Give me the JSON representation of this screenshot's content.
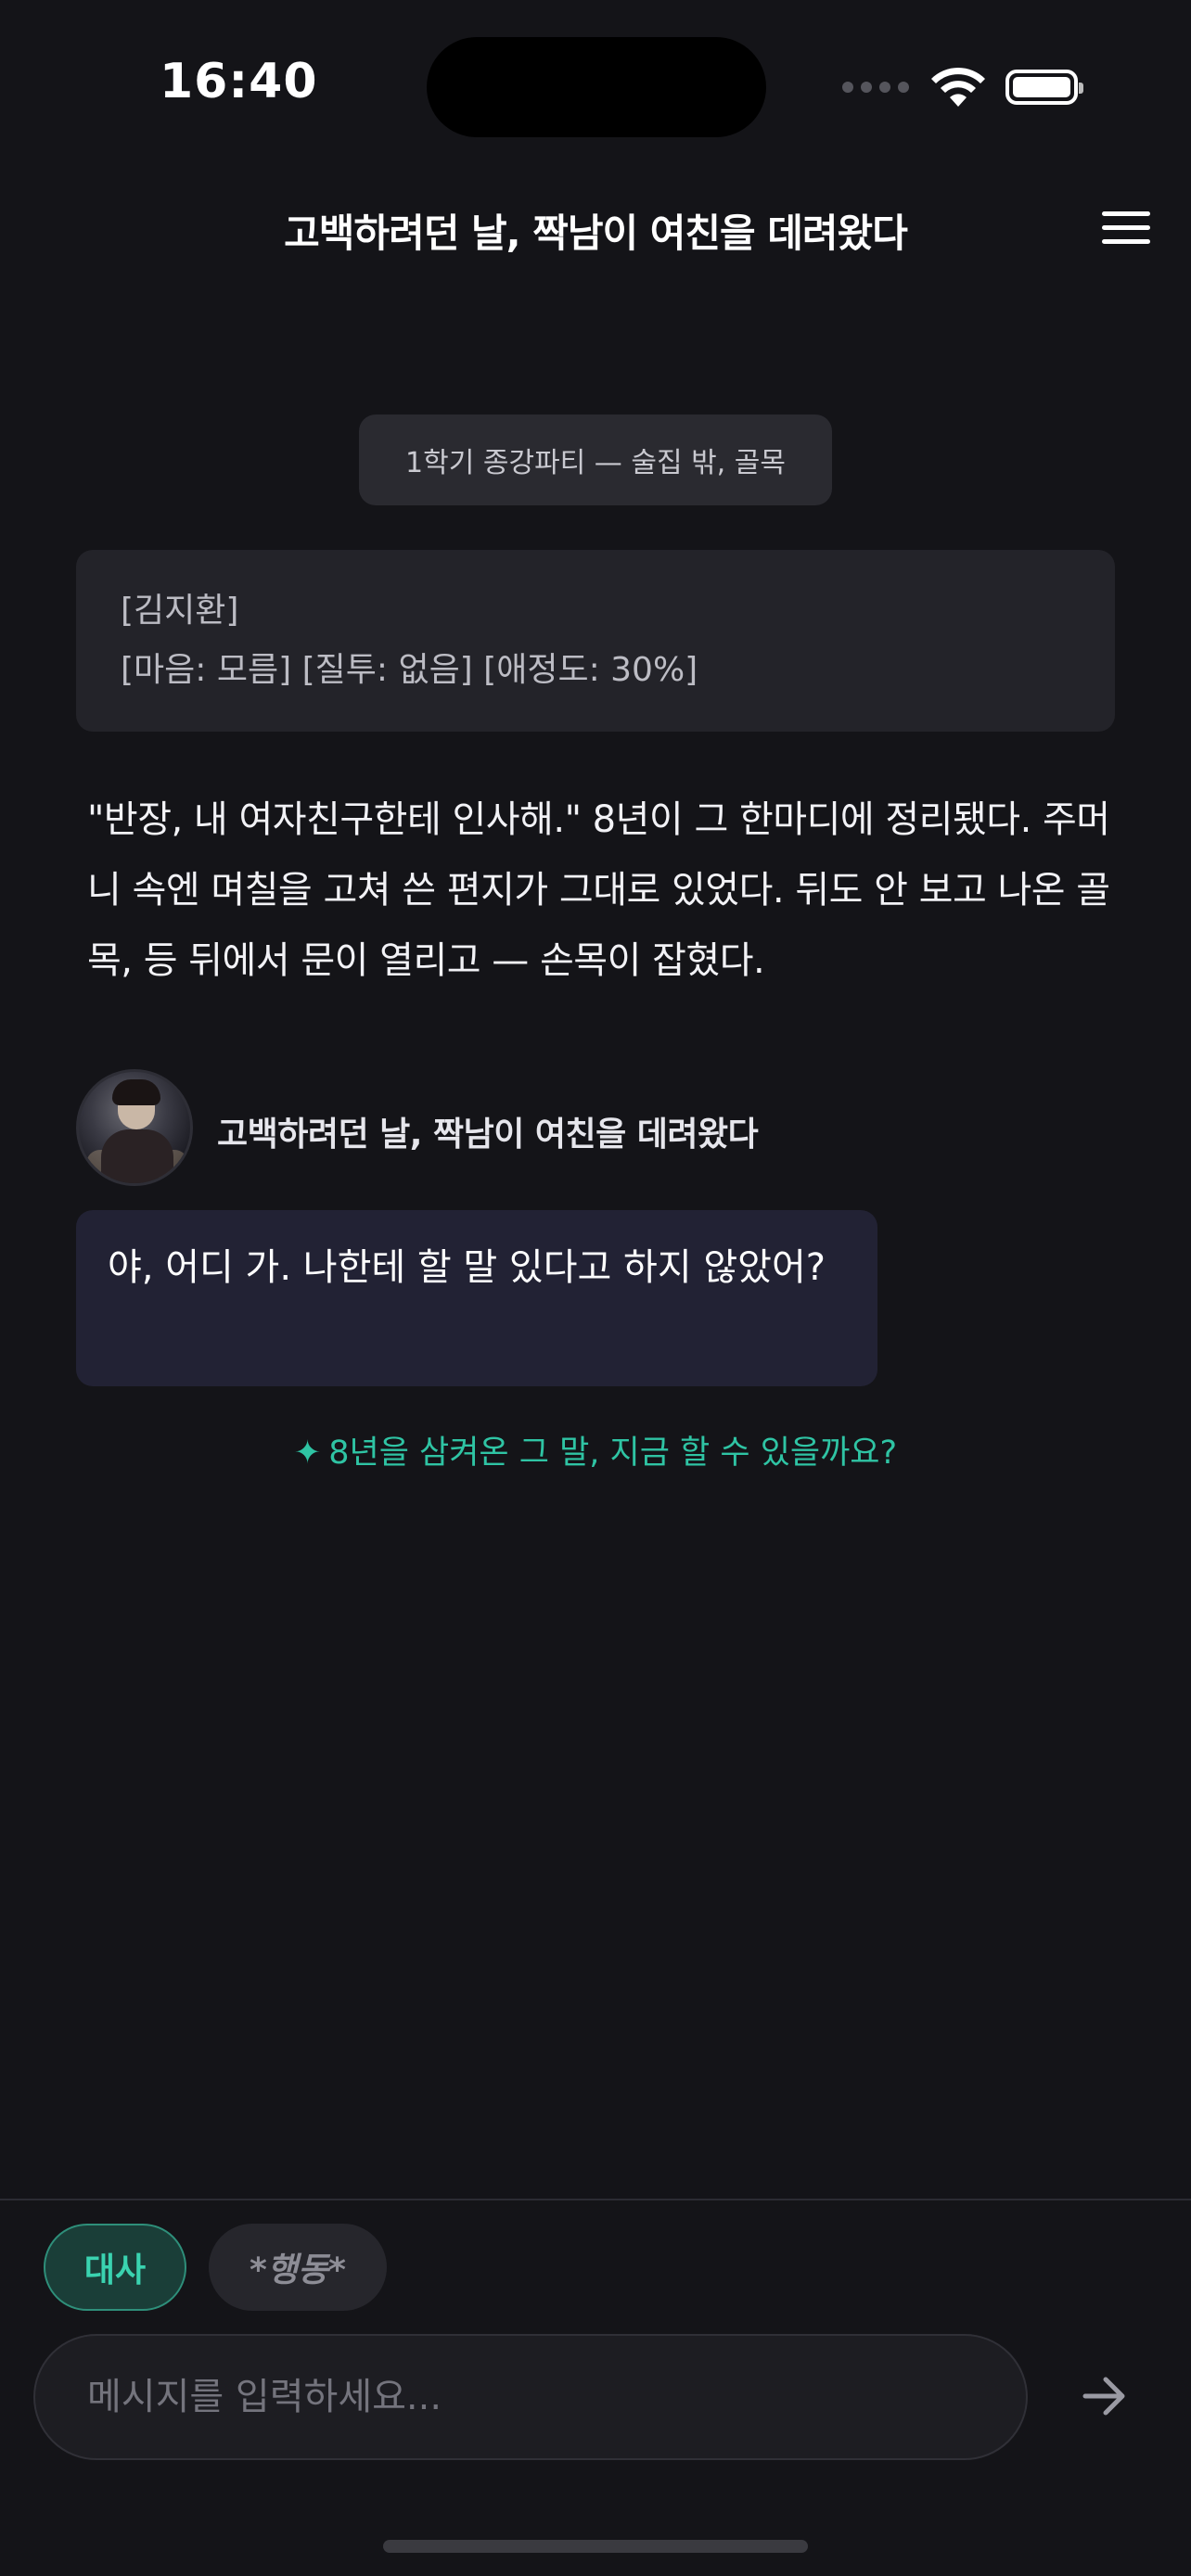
{
  "status_bar": {
    "time": "16:40"
  },
  "header": {
    "title": "고백하려던 날, 짝남이 여친을 데려왔다",
    "menu_icon": "hamburger-menu-icon"
  },
  "scene": {
    "label": "1학기 종강파티 — 술집 밖, 골목"
  },
  "status_card": {
    "name_line": "[김지환]",
    "stats_line": "[마음: 모름] [질투: 없음] [애정도: 30%]"
  },
  "narration": {
    "text": "\"반장, 내 여자친구한테 인사해.\" 8년이 그 한마디에 정리됐다. 주머니 속엔 며칠을 고쳐 쓴 편지가 그대로 있었다. 뒤도 안 보고 나온 골목, 등 뒤에서 문이 열리고 — 손목이 잡혔다."
  },
  "character": {
    "name": "고백하려던 날, 짝남이 여친을 데려왔다",
    "message": "야, 어디 가. 나한테 할 말 있다고 하지 않았어?"
  },
  "hint": {
    "icon": "✦",
    "text": "8년을 삼켜온 그 말, 지금 할 수 있을까요?"
  },
  "composer": {
    "tabs": [
      {
        "label": "대사",
        "active": true
      },
      {
        "label": "*행동*",
        "active": false
      }
    ],
    "input_placeholder": "메시지를 입력하세요...",
    "input_value": "",
    "send_icon": "arrow-right-icon"
  },
  "colors": {
    "background": "#141418",
    "accent": "#2FC4A4",
    "bubble": "#222234"
  }
}
